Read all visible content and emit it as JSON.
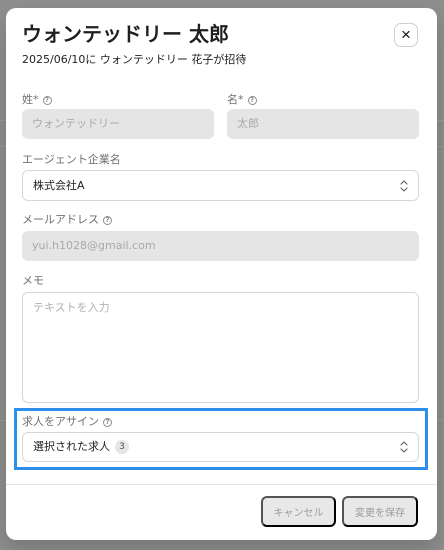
{
  "dialog": {
    "title": "ウォンテッドリー 太郎",
    "subtitle": "2025/06/10に ウォンテッドリー 花子が招待",
    "close_icon": "×"
  },
  "fields": {
    "last_name": {
      "label": "姓*",
      "value": "ウォンテッドリー"
    },
    "first_name": {
      "label": "名*",
      "value": "太郎"
    },
    "agent_company": {
      "label": "エージェント企業名",
      "value": "株式会社A"
    },
    "email": {
      "label": "メールアドレス",
      "value": "yui.h1028@gmail.com"
    },
    "memo": {
      "label": "メモ",
      "placeholder": "テキストを入力"
    },
    "job_assign": {
      "label": "求人をアサイン",
      "value": "選択された求人",
      "count": "3"
    }
  },
  "actions": {
    "cancel": "キャンセル",
    "save": "変更を保存"
  },
  "icons": {
    "help": "help-circle-icon",
    "select": "chevron-up-down-icon",
    "close": "close-icon"
  },
  "colors": {
    "highlight": "#2f8eea",
    "disabled_field": "#e5e5e5",
    "border": "#d7d7d7"
  }
}
